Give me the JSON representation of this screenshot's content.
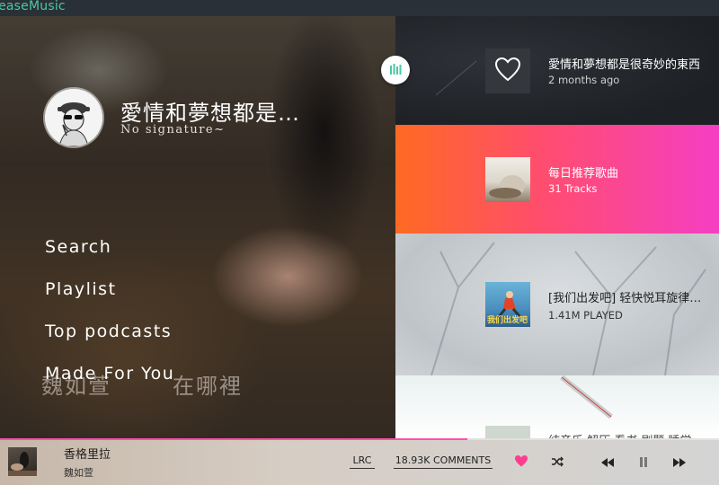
{
  "app": {
    "title": "ieaseMusic"
  },
  "profile": {
    "username": "愛情和夢想都是…",
    "signature": "No signature~"
  },
  "nav": {
    "items": [
      {
        "label": "Search"
      },
      {
        "label": "Playlist"
      },
      {
        "label": "Top podcasts"
      },
      {
        "label": "Made For You"
      }
    ]
  },
  "background": {
    "watermark_left": "魏如萱",
    "watermark_right": "在哪裡"
  },
  "cards": [
    {
      "title": "愛情和夢想都是很奇妙的東西",
      "subtitle": "2 months ago",
      "icon": "heart-icon"
    },
    {
      "title": "每日推荐歌曲",
      "subtitle": "31 Tracks"
    },
    {
      "title": "[我们出发吧] 轻快悦耳旋律嗨翻全场",
      "subtitle": "1.41M PLAYED",
      "thumb_text": "我们出发吧"
    },
    {
      "title": "纯音乐 解压 看书 刷题 睡觉",
      "subtitle": ""
    }
  ],
  "player": {
    "song": "香格里拉",
    "artist": "魏如萱",
    "lrc_label": "LRC",
    "comments_label": "18.93K COMMENTS",
    "progress": 0.65,
    "accent": "#ff4fae"
  },
  "colors": {
    "titlebar_text": "#48c9a4",
    "card_gradient_start": "#ff6a22",
    "card_gradient_end": "#f63ec4"
  }
}
